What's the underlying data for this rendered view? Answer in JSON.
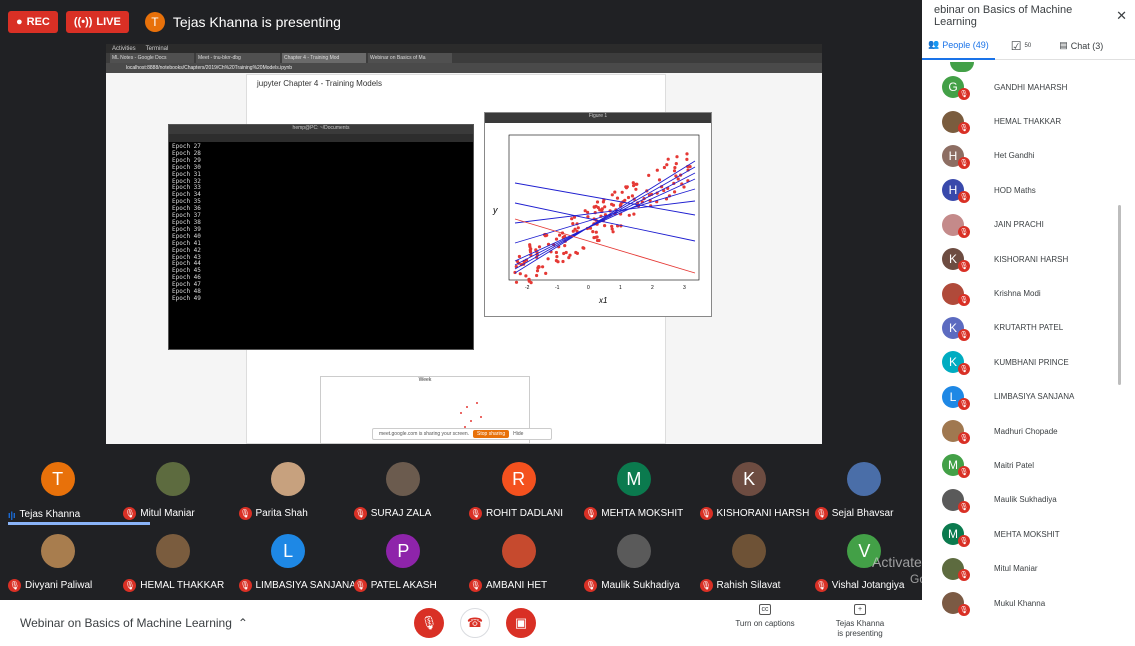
{
  "topbar": {
    "rec_label": "REC",
    "live_label": "LIVE",
    "presenter_initial": "T",
    "presenting_text": "Tejas Khanna is presenting"
  },
  "screen": {
    "os_bar": [
      "Activities",
      "Terminal"
    ],
    "tabs": [
      "ML Notes - Google Docs",
      "Meet - tnu-bkrr-dbg",
      "Chapter 4 - Training Mod",
      "Webinar on Basics of Ma"
    ],
    "url": "localhost:8888/notebooks/Chapters/2019/Ch%20Training%20Models.ipynb",
    "jupyter_title": "jupyter  Chapter 4 - Training Models",
    "terminal_title": "hemp@PC: ~/Documents",
    "terminal_lines": [
      "Epoch 27",
      "Epoch 28",
      "Epoch 29",
      "Epoch 30",
      "Epoch 31",
      "Epoch 32",
      "Epoch 33",
      "Epoch 34",
      "Epoch 35",
      "Epoch 36",
      "Epoch 37",
      "Epoch 38",
      "Epoch 39",
      "Epoch 40",
      "Epoch 41",
      "Epoch 42",
      "Epoch 43",
      "Epoch 44",
      "Epoch 45",
      "Epoch 46",
      "Epoch 47",
      "Epoch 48",
      "Epoch 49"
    ],
    "figure_title": "Figure 1",
    "plot": {
      "ylabel": "y",
      "xlabel": "x1",
      "xticks": [
        "-2",
        "-1",
        "0",
        "1",
        "2",
        "3"
      ]
    },
    "second_plot_title": "Week",
    "share_text": "meet.google.com is sharing your screen.",
    "stop_label": "Stop sharing",
    "hide_label": "Hide"
  },
  "tiles_row1": [
    {
      "name": "Tejas Khanna",
      "initial": "T",
      "color": "#e8710a",
      "speaking": true
    },
    {
      "name": "Mitul Maniar",
      "initial": "",
      "color": "#5d6b3f",
      "photo": true
    },
    {
      "name": "Parita Shah",
      "initial": "",
      "color": "#c7a17e",
      "photo": true
    },
    {
      "name": "SURAJ ZALA",
      "initial": "",
      "color": "#6b5b4e",
      "photo": true
    },
    {
      "name": "ROHIT DADLANI",
      "initial": "R",
      "color": "#f4511e"
    },
    {
      "name": "MEHTA MOKSHIT",
      "initial": "M",
      "color": "#0b7a4e"
    },
    {
      "name": "KISHORANI HARSH",
      "initial": "K",
      "color": "#6d4c41"
    },
    {
      "name": "Sejal Bhavsar",
      "initial": "",
      "color": "#4a6ea8",
      "photo": true
    }
  ],
  "tiles_row2": [
    {
      "name": "Divyani Paliwal",
      "initial": "",
      "color": "#a87d4e",
      "photo": true
    },
    {
      "name": "HEMAL THAKKAR",
      "initial": "",
      "color": "#7a5c3e",
      "photo": true
    },
    {
      "name": "LIMBASIYA SANJANA",
      "initial": "L",
      "color": "#1e88e5"
    },
    {
      "name": "PATEL AKASH",
      "initial": "P",
      "color": "#8e24aa"
    },
    {
      "name": "AMBANI HET",
      "initial": "",
      "color": "#c64a2e",
      "photo": true
    },
    {
      "name": "Maulik Sukhadiya",
      "initial": "",
      "color": "#5a5a5a",
      "photo": true
    },
    {
      "name": "Rahish Silavat",
      "initial": "",
      "color": "#6e5236",
      "photo": true
    },
    {
      "name": "Vishal Jotangiya",
      "initial": "V",
      "color": "#43a047"
    }
  ],
  "watermark": {
    "line1": "Activate Windows",
    "line2": "Go to PC settings to activate Windows."
  },
  "bottom": {
    "meeting_title": "Webinar on Basics of Machine Learning",
    "captions_label": "Turn on captions",
    "presenting_label_1": "Tejas Khanna",
    "presenting_label_2": "is presenting"
  },
  "panel": {
    "title": "ebinar on Basics of Machine Learning",
    "close": "✕",
    "tab_people": "People (49)",
    "tab_tasks_count": "50",
    "tab_chat": "Chat (3)",
    "people": [
      {
        "name": "GANDHI MAHARSH",
        "initial": "G",
        "color": "#43a047"
      },
      {
        "name": "HEMAL THAKKAR",
        "initial": "",
        "color": "#7a5c3e",
        "photo": true
      },
      {
        "name": "Het Gandhi",
        "initial": "H",
        "color": "#8d6e63"
      },
      {
        "name": "HOD Maths",
        "initial": "H",
        "color": "#3949ab"
      },
      {
        "name": "JAIN PRACHI",
        "initial": "",
        "color": "#c48a8a",
        "photo": true
      },
      {
        "name": "KISHORANI HARSH",
        "initial": "K",
        "color": "#6d4c41"
      },
      {
        "name": "Krishna Modi",
        "initial": "",
        "color": "#b04a3a",
        "photo": true
      },
      {
        "name": "KRUTARTH PATEL",
        "initial": "K",
        "color": "#5c6bc0"
      },
      {
        "name": "KUMBHANI PRINCE",
        "initial": "K",
        "color": "#00acc1"
      },
      {
        "name": "LIMBASIYA SANJANA",
        "initial": "L",
        "color": "#1e88e5"
      },
      {
        "name": "Madhuri Chopade",
        "initial": "",
        "color": "#a07850",
        "photo": true
      },
      {
        "name": "Maitri Patel",
        "initial": "M",
        "color": "#43a047"
      },
      {
        "name": "Maulik Sukhadiya",
        "initial": "",
        "color": "#5a5a5a",
        "photo": true
      },
      {
        "name": "MEHTA MOKSHIT",
        "initial": "M",
        "color": "#0b7a4e"
      },
      {
        "name": "Mitul Maniar",
        "initial": "",
        "color": "#5d6b3f",
        "photo": true
      },
      {
        "name": "Mukul Khanna",
        "initial": "",
        "color": "#7b5a44",
        "photo": true
      }
    ]
  }
}
